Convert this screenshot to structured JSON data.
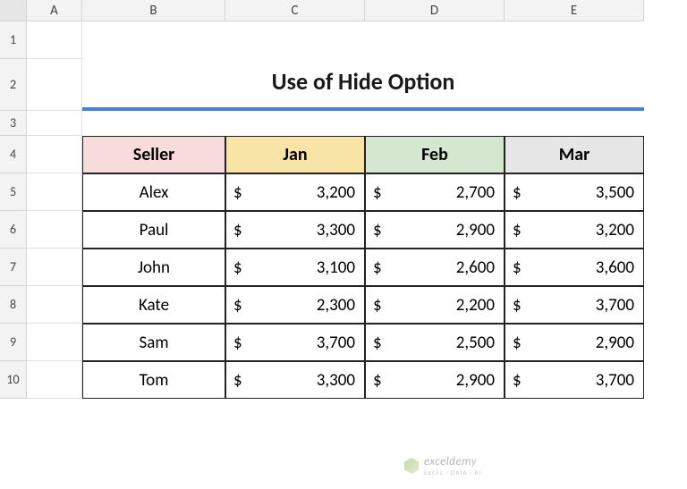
{
  "columns": [
    "A",
    "B",
    "C",
    "D",
    "E"
  ],
  "rows": [
    "1",
    "2",
    "3",
    "4",
    "5",
    "6",
    "7",
    "8",
    "9",
    "10"
  ],
  "title": "Use of Hide Option",
  "headers": {
    "seller": "Seller",
    "jan": "Jan",
    "feb": "Feb",
    "mar": "Mar"
  },
  "currency": "$",
  "data": [
    {
      "seller": "Alex",
      "jan": "3,200",
      "feb": "2,700",
      "mar": "3,500"
    },
    {
      "seller": "Paul",
      "jan": "3,300",
      "feb": "2,900",
      "mar": "3,200"
    },
    {
      "seller": "John",
      "jan": "3,100",
      "feb": "2,600",
      "mar": "3,600"
    },
    {
      "seller": "Kate",
      "jan": "2,300",
      "feb": "2,200",
      "mar": "3,700"
    },
    {
      "seller": "Sam",
      "jan": "3,700",
      "feb": "2,500",
      "mar": "2,900"
    },
    {
      "seller": "Tom",
      "jan": "3,300",
      "feb": "2,900",
      "mar": "3,700"
    }
  ],
  "watermark": {
    "name": "exceldemy",
    "sub": "EXCEL · DATA · BI"
  }
}
